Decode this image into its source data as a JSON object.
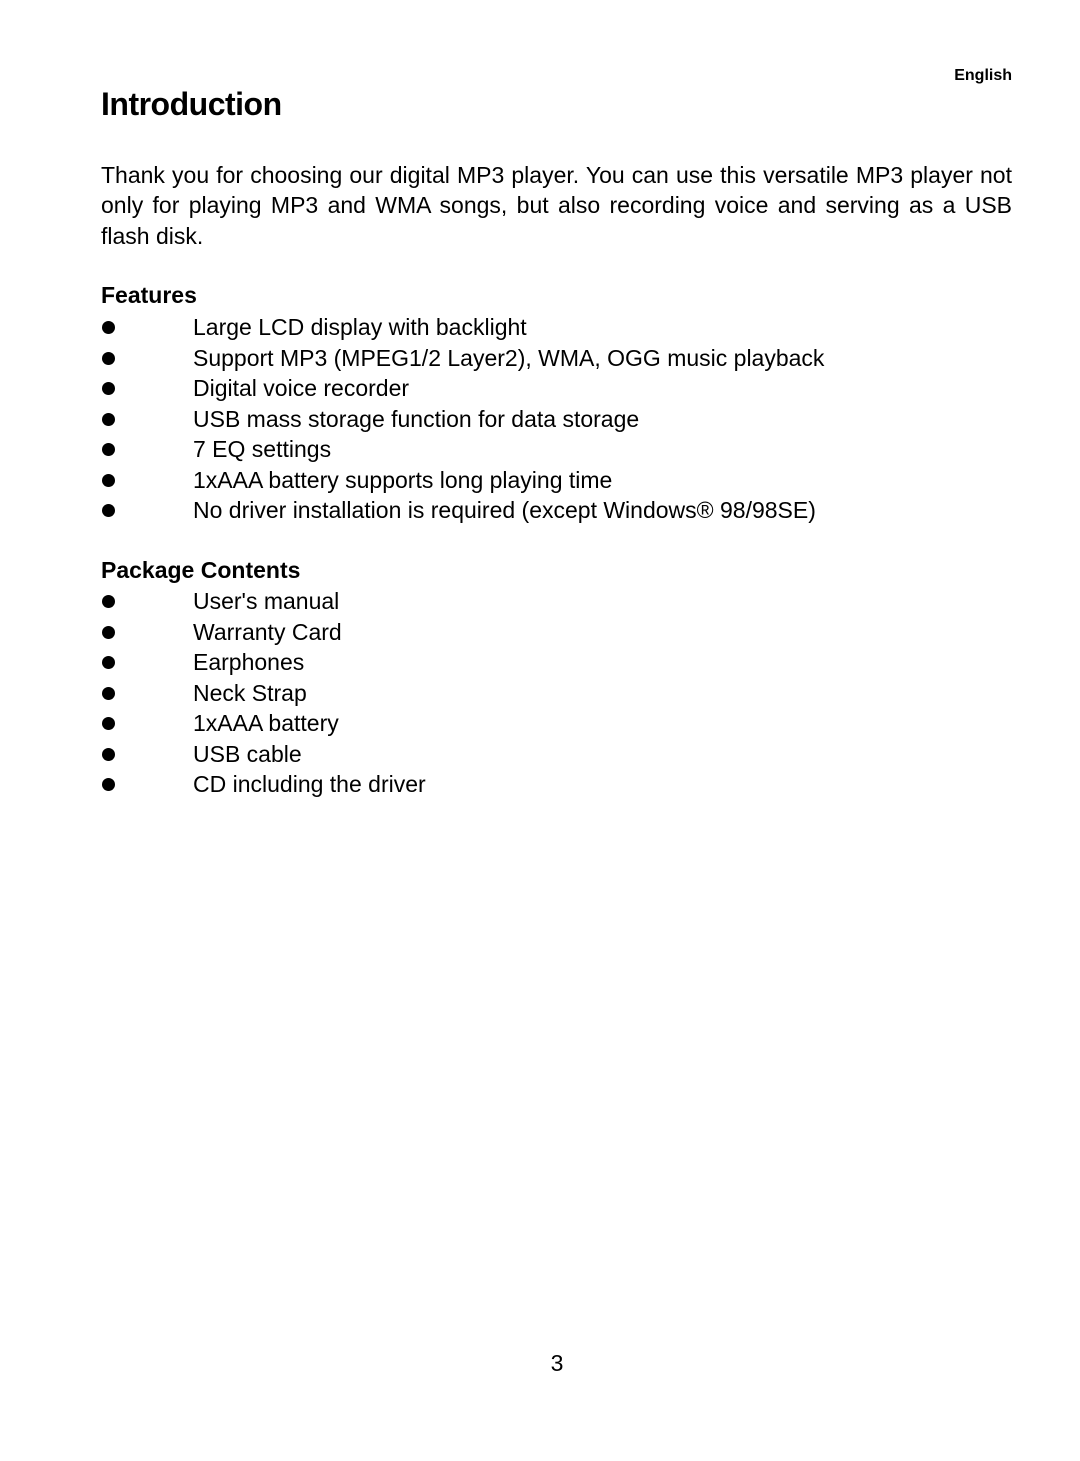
{
  "header": {
    "language": "English"
  },
  "title": "Introduction",
  "intro": "Thank you for choosing our digital MP3 player. You can use this versatile MP3 player not only for playing MP3 and WMA songs, but also recording voice and serving as a USB flash disk.",
  "features": {
    "heading": "Features",
    "items": [
      "Large LCD display with backlight",
      "Support MP3 (MPEG1/2 Layer2), WMA, OGG music playback",
      "Digital voice recorder",
      "USB mass storage function for data storage",
      "7 EQ settings",
      "1xAAA battery supports long playing time",
      "No driver installation is required (except Windows® 98/98SE)"
    ]
  },
  "package": {
    "heading": "Package Contents",
    "items": [
      "User's manual",
      "Warranty Card",
      "Earphones",
      "Neck Strap",
      "1xAAA battery",
      "USB cable",
      "CD including the driver"
    ]
  },
  "footer": {
    "page_number": "3"
  }
}
